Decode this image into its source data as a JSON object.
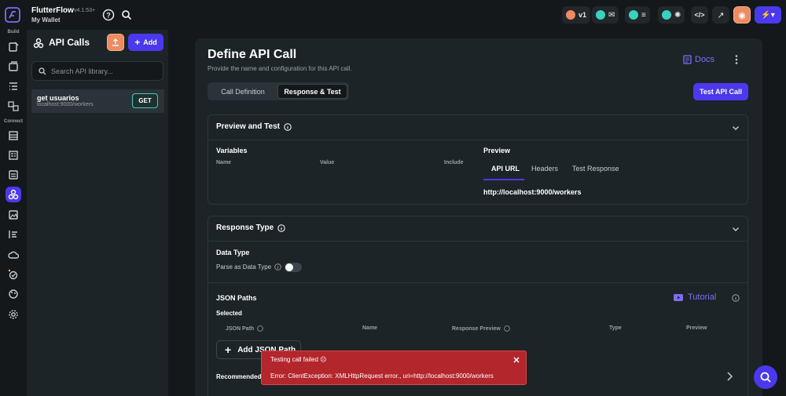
{
  "app": {
    "title": "FlutterFlow",
    "version": "v4.1.53+",
    "project": "My Wallet"
  },
  "topbar": {
    "version_pill": "v1"
  },
  "rail": {
    "build_label": "Build",
    "connect_label": "Connect"
  },
  "panel": {
    "title": "API Calls",
    "add_label": "Add",
    "search_placeholder": "Search API library...",
    "items": [
      {
        "name": "get usuarios",
        "url": "localhost:9000/workers",
        "method": "GET"
      }
    ]
  },
  "main": {
    "title": "Define API Call",
    "subtitle": "Provide the name and configuration for this API call.",
    "docs_label": "Docs",
    "tabs": [
      {
        "label": "Call Definition",
        "active": false
      },
      {
        "label": "Response & Test",
        "active": true
      }
    ],
    "test_button": "Test API Call",
    "preview_section": {
      "title": "Preview and Test",
      "variables_label": "Variables",
      "columns": [
        "Name",
        "Value",
        "Include"
      ],
      "preview_label": "Preview",
      "preview_tabs": [
        "API URL",
        "Headers",
        "Test Response"
      ],
      "url": "http://localhost:9000/workers"
    },
    "response_section": {
      "title": "Response Type",
      "data_type_label": "Data Type",
      "parse_label": "Parse as Data Type",
      "json_paths_label": "JSON Paths",
      "tutorial_label": "Tutorial",
      "selected_label": "Selected",
      "columns": [
        "JSON Path",
        "Name",
        "Response Preview",
        "Type",
        "Preview"
      ],
      "add_json_path": "Add JSON Path",
      "recommended_label": "Recommended"
    }
  },
  "toast": {
    "title": "Testing call failed ☹",
    "message": "Error: ClientException: XMLHttpRequest error., uri=http://localhost:9000/workers"
  },
  "colors": {
    "accent": "#4b39ef",
    "error": "#b3262b",
    "teal": "#39d2c0",
    "orange": "#ee8b60"
  }
}
